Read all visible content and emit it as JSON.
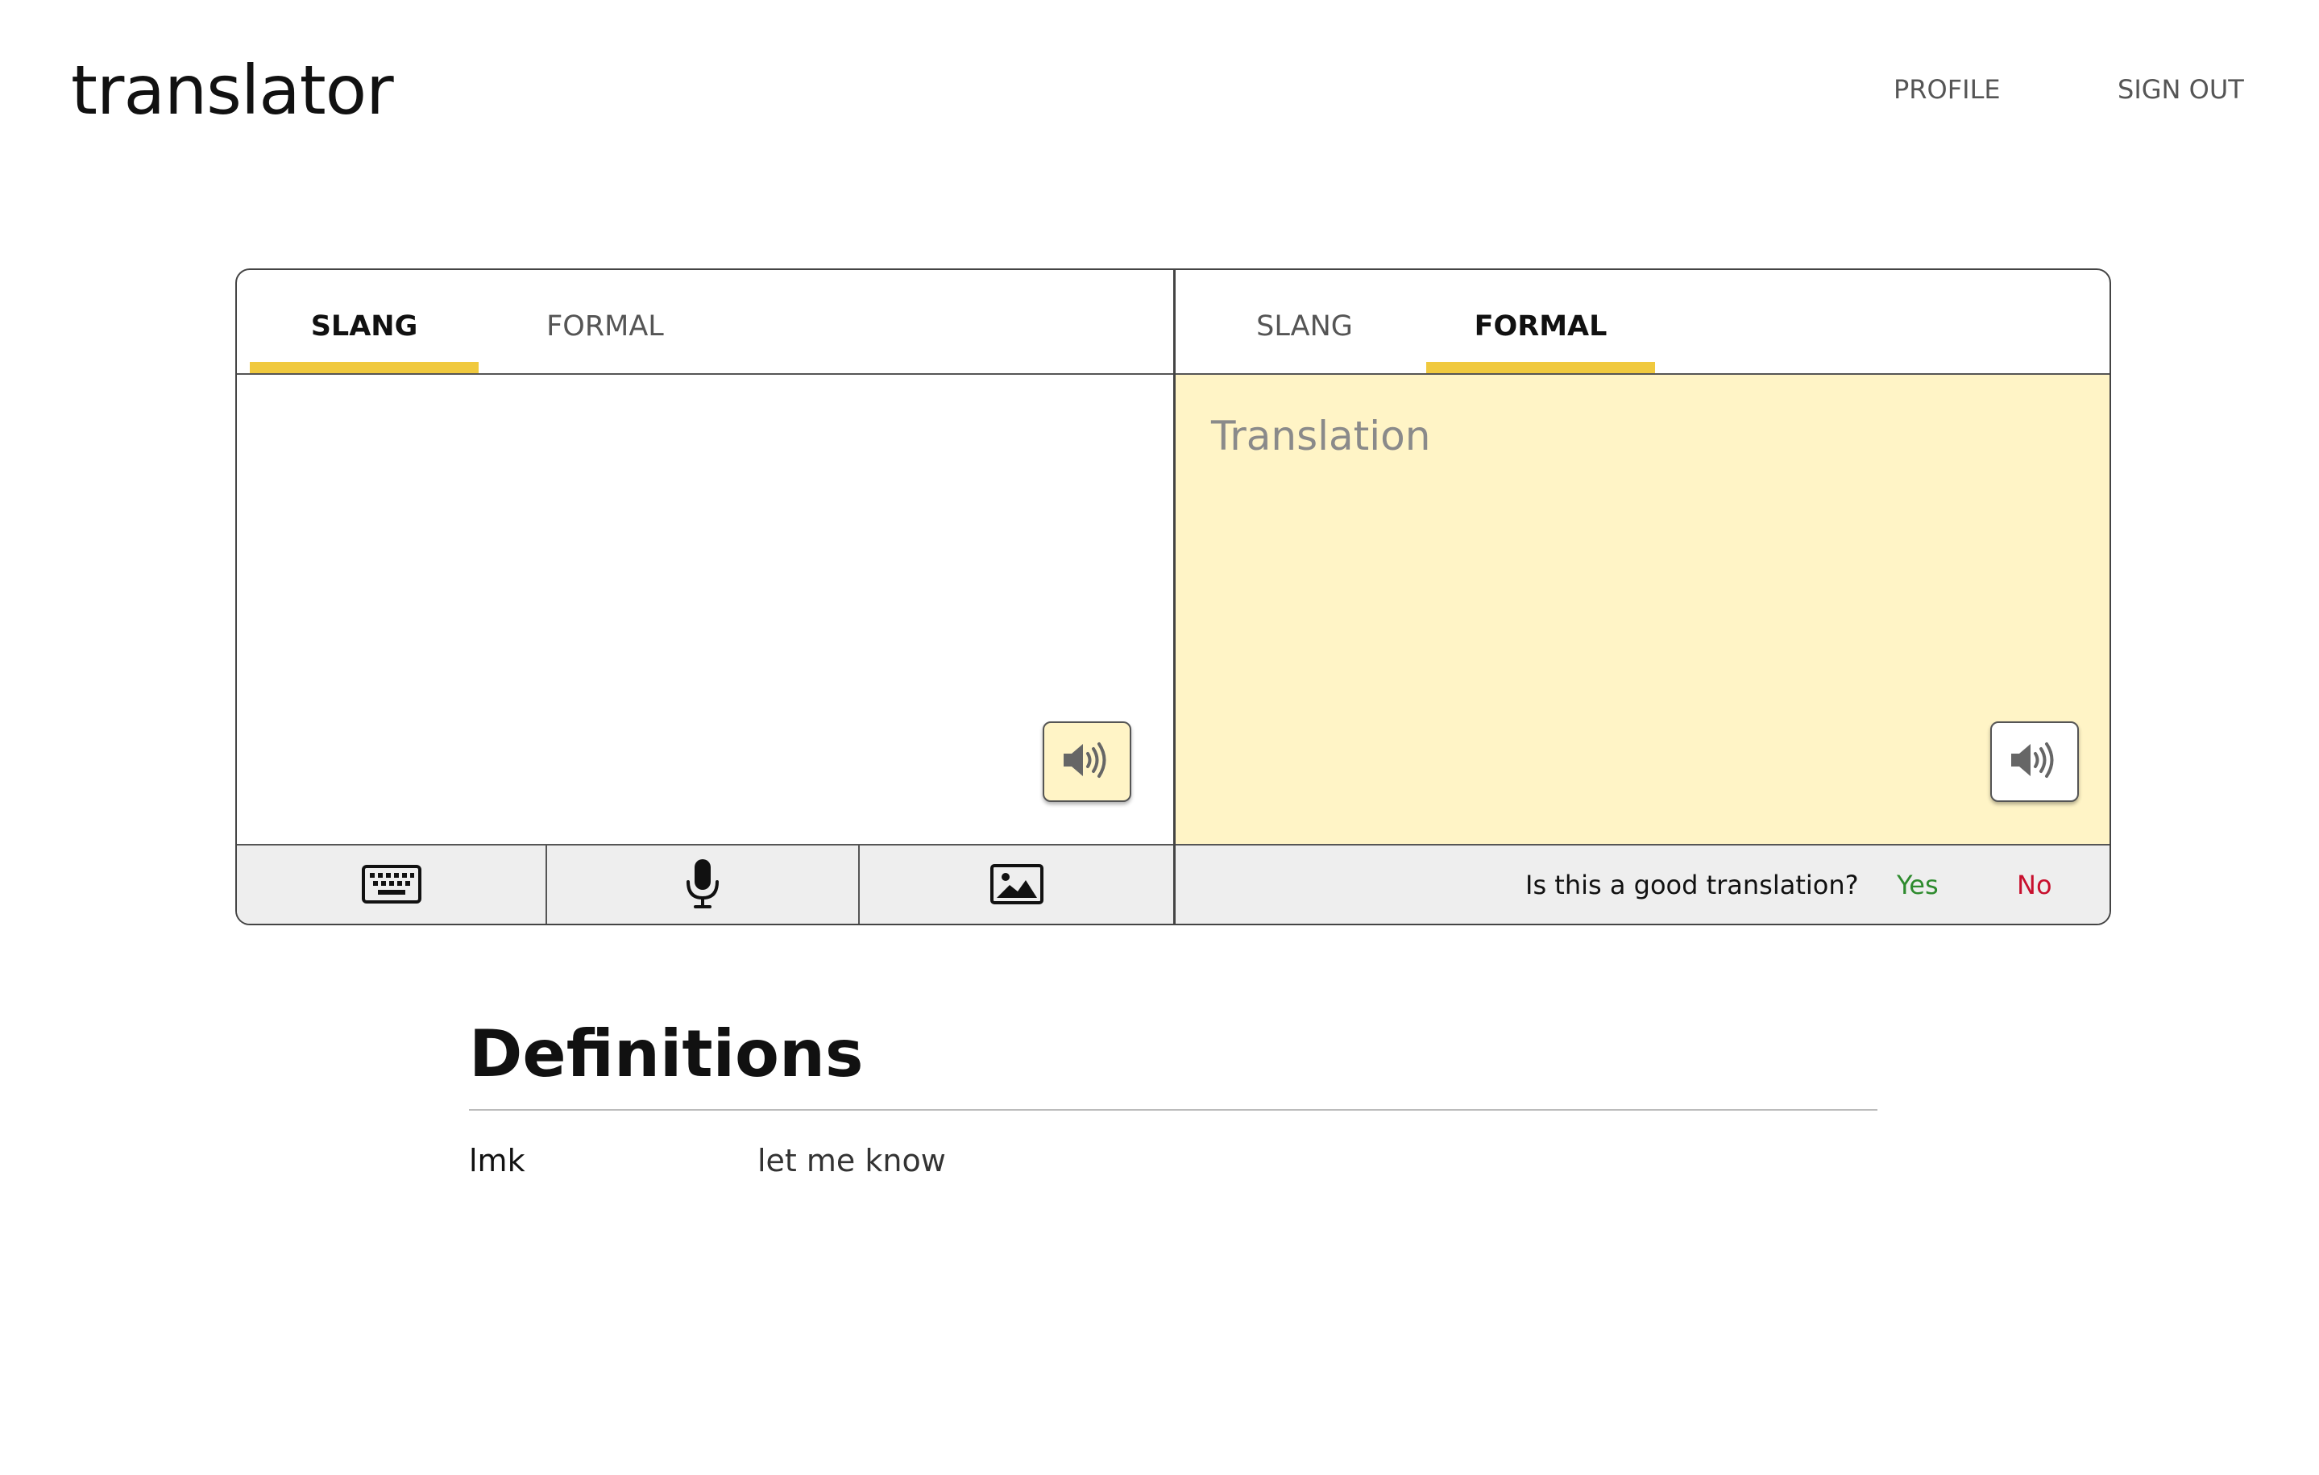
{
  "header": {
    "app_title": "translator",
    "nav": {
      "profile": "PROFILE",
      "sign_out": "SIGN OUT"
    }
  },
  "translator": {
    "source": {
      "tabs": [
        {
          "label": "SLANG",
          "active": true
        },
        {
          "label": "FORMAL",
          "active": false
        }
      ],
      "input_value": "",
      "input_modes": [
        "keyboard-icon",
        "microphone-icon",
        "image-icon"
      ]
    },
    "target": {
      "tabs": [
        {
          "label": "SLANG",
          "active": false
        },
        {
          "label": "FORMAL",
          "active": true
        }
      ],
      "placeholder": "Translation",
      "feedback": {
        "question": "Is this a good translation?",
        "yes": "Yes",
        "no": "No"
      }
    },
    "accent_color": "#f0c93e",
    "output_background": "#fff4c6"
  },
  "definitions": {
    "title": "Definitions",
    "items": [
      {
        "term": "lmk",
        "meaning": "let me know"
      }
    ]
  }
}
